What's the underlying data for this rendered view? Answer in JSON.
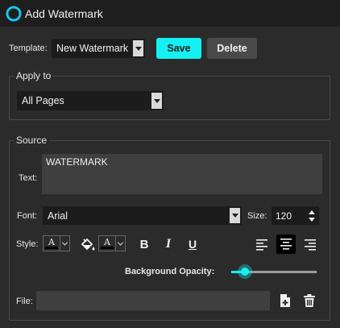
{
  "window": {
    "title": "Add Watermark",
    "logo_icon": "logo-icon"
  },
  "template": {
    "label": "Template:",
    "selected": "New Watermark",
    "save_label": "Save",
    "delete_label": "Delete"
  },
  "apply_to": {
    "legend": "Apply to",
    "selected": "All Pages"
  },
  "source": {
    "legend": "Source",
    "text_label": "Text:",
    "text_value": "WATERMARK",
    "font_label": "Font:",
    "font_value": "Arial",
    "size_label": "Size:",
    "size_value": "120",
    "style_label": "Style:",
    "text_color_glyph": "A",
    "highlight_color_glyph": "A",
    "bold_glyph": "B",
    "italic_glyph": "I",
    "underline_glyph": "U",
    "opacity_label": "Background Opacity:",
    "opacity_value": 0.12,
    "file_label": "File:",
    "file_value": ""
  },
  "colors": {
    "accent": "#14f0f3",
    "background": "#2b2b2b",
    "titlebar": "#1e1e1e"
  }
}
